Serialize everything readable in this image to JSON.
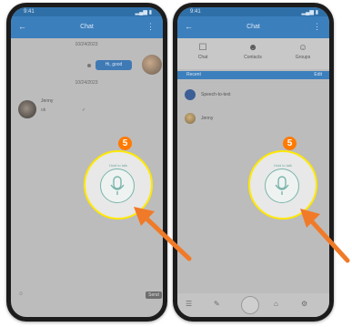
{
  "left_phone": {
    "status": {
      "time": "9:41",
      "signals": "▂▄▆ ▮"
    },
    "appbar": {
      "title": "Chat",
      "back": "←",
      "menu": "⋮"
    },
    "date_top": "10/24/2023",
    "outgoing_message": "Hi, good",
    "date_mid": "10/24/2023",
    "incoming": {
      "name": "Jenny",
      "text": "ok",
      "mark": "✓"
    },
    "bottom_left": "☺",
    "send_label": "Send"
  },
  "right_phone": {
    "status": {
      "time": "9:41",
      "signals": "▂▄▆ ▮"
    },
    "appbar": {
      "title": "Chat",
      "back": "←",
      "menu": "⋮"
    },
    "tabs": [
      {
        "label": "Chat",
        "icon": "☐"
      },
      {
        "label": "Contacts",
        "icon": "☻"
      },
      {
        "label": "Groups",
        "icon": "☺"
      }
    ],
    "section_left": "Recent",
    "section_right": "Edit",
    "items": [
      {
        "label": "Speech-to-text"
      },
      {
        "label": "Jenny"
      }
    ],
    "nav": [
      "☰",
      "✎",
      "",
      "⌂",
      "⚙"
    ]
  },
  "callouts": {
    "left": {
      "step": "5",
      "hint": "Hold to talk"
    },
    "right": {
      "step": "5",
      "hint": "Hold to talk"
    }
  },
  "colors": {
    "highlight_ring": "#ffe800",
    "step_badge": "#ff7a00",
    "arrow": "#f07a28",
    "app_blue": "#3c7fbd"
  }
}
